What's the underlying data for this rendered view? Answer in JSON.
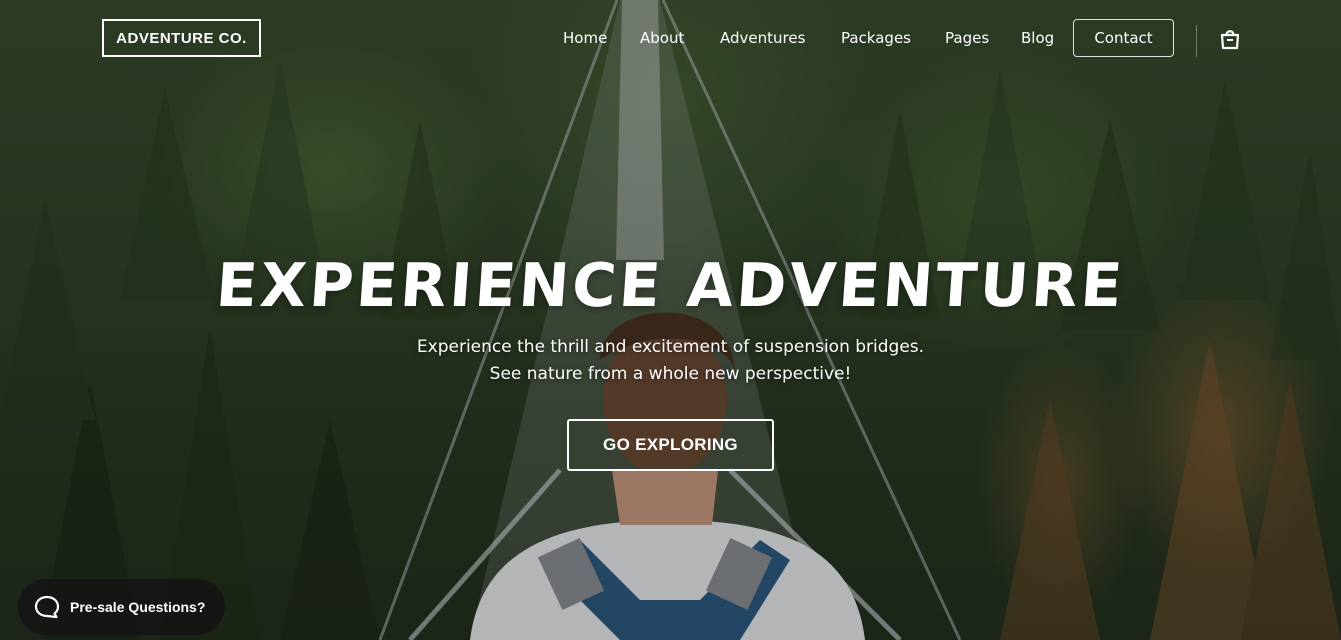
{
  "brand": {
    "logo_text": "ADVENTURE CO."
  },
  "nav": {
    "items": [
      {
        "label": "Home"
      },
      {
        "label": "About"
      },
      {
        "label": "Adventures"
      },
      {
        "label": "Packages"
      },
      {
        "label": "Pages"
      },
      {
        "label": "Blog"
      }
    ],
    "contact_label": "Contact",
    "cart_icon": "shopping-bag-icon"
  },
  "hero": {
    "title": "Experience Adventure",
    "subtitle_line1": "Experience the thrill and excitement of suspension bridges.",
    "subtitle_line2": "See nature from a whole new perspective!",
    "cta_label": "GO EXPLORING"
  },
  "chat_widget": {
    "label": "Pre-sale Questions?",
    "icon": "chat-bubble-icon"
  },
  "colors": {
    "text": "#ffffff",
    "forest_dark": "#24301f",
    "forest_mid": "#3a4a2e",
    "chat_bg": "#141414"
  }
}
